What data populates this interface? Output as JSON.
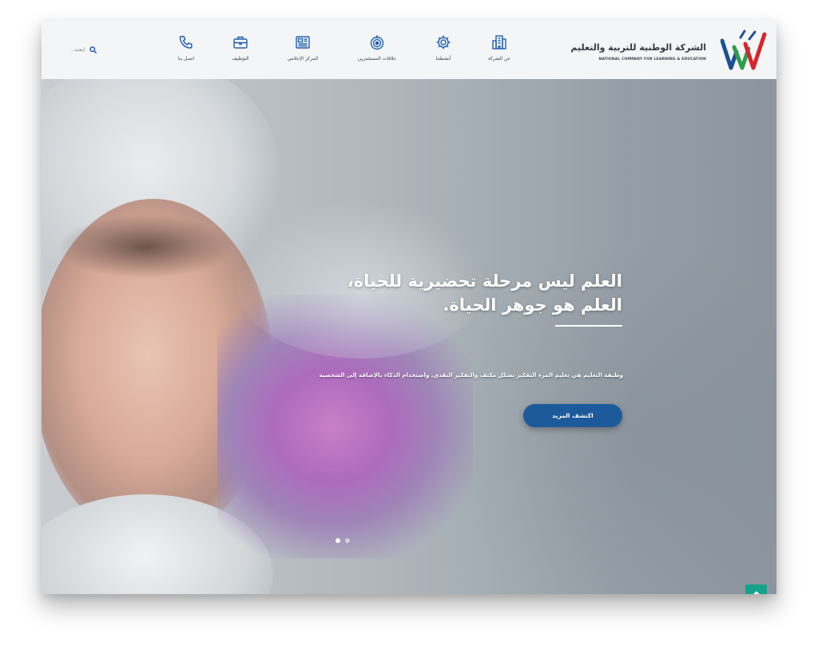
{
  "brand": {
    "name_ar": "الشركة الوطنية للتربية والتعليم",
    "name_en": "NATIONAL COMPANY FOR LEARNING & EDUCATION",
    "colors": {
      "blue": "#1b4f93",
      "green": "#2f9d4a",
      "red": "#d8242c",
      "accent": "#1d5a9b",
      "teal": "#14a38c"
    }
  },
  "nav": {
    "items": [
      {
        "label": "عن الشركة",
        "icon": "building-icon"
      },
      {
        "label": "أنشطتنا",
        "icon": "gear-icon"
      },
      {
        "label": "علاقات المستثمرين",
        "icon": "target-icon"
      },
      {
        "label": "المركز الإعلامي",
        "icon": "newspaper-icon"
      },
      {
        "label": "التوظيف",
        "icon": "briefcase-icon"
      },
      {
        "label": "اتصل بنا",
        "icon": "phone-icon"
      }
    ]
  },
  "search": {
    "placeholder": "ابحث..",
    "icon": "search-icon"
  },
  "hero": {
    "title_line1": "العلم ليس مرحلة تحضيرية للحياة،",
    "title_line2": "العلم هو جوهر الحياة.",
    "description": "وظيفة التعليم هي تعليم المرء التفكير بشكل مكثف والتفكير النقدي, واستخدام الذكاء بالإضافة إلى الشخصية",
    "cta_label": "اكتشف المزيد"
  },
  "slider": {
    "slides": 2,
    "active": 1
  },
  "scroll_top": {
    "icon": "arrow-up-icon"
  }
}
